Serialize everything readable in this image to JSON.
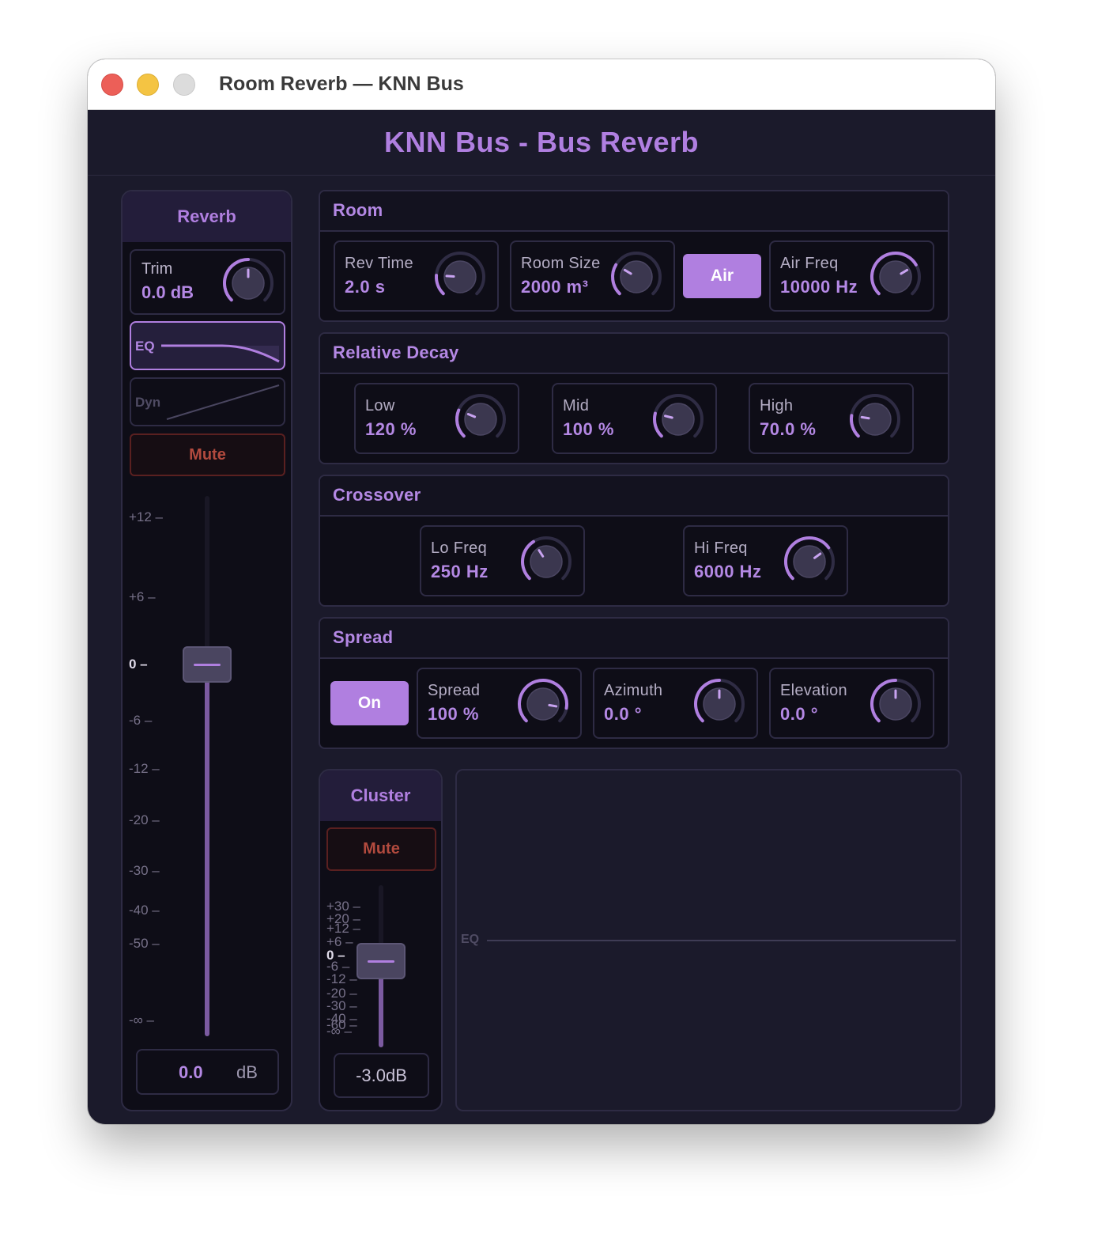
{
  "window": {
    "title": "Room Reverb — KNN Bus"
  },
  "header": {
    "title": "KNN Bus - Bus Reverb"
  },
  "reverb_strip": {
    "title": "Reverb",
    "trim": {
      "label": "Trim",
      "value": "0.0 dB",
      "level": 0.5
    },
    "eq_label": "EQ",
    "dyn_label": "Dyn",
    "mute_label": "Mute",
    "scale": [
      "+12",
      "+6",
      "0",
      "-6",
      "-12",
      "-20",
      "-30",
      "-40",
      "-50",
      "-∞"
    ],
    "fader_db": 0.0,
    "readout_value": "0.0",
    "readout_unit": "dB"
  },
  "room": {
    "title": "Room",
    "rev_time": {
      "label": "Rev Time",
      "value": "2.0 s",
      "level": 0.18
    },
    "room_size": {
      "label": "Room Size",
      "value": "2000 m³",
      "level": 0.28
    },
    "air_button": "Air",
    "air_freq": {
      "label": "Air Freq",
      "value": "10000 Hz",
      "level": 0.72
    }
  },
  "relative_decay": {
    "title": "Relative Decay",
    "low": {
      "label": "Low",
      "value": "120 %",
      "level": 0.25
    },
    "mid": {
      "label": "Mid",
      "value": "100 %",
      "level": 0.22
    },
    "high": {
      "label": "High",
      "value": "70.0 %",
      "level": 0.2
    }
  },
  "crossover": {
    "title": "Crossover",
    "lo_freq": {
      "label": "Lo Freq",
      "value": "250 Hz",
      "level": 0.38
    },
    "hi_freq": {
      "label": "Hi Freq",
      "value": "6000 Hz",
      "level": 0.7
    }
  },
  "spread": {
    "title": "Spread",
    "on_button": "On",
    "spread": {
      "label": "Spread",
      "value": "100 %",
      "level": 0.87
    },
    "azimuth": {
      "label": "Azimuth",
      "value": "0.0 °",
      "level": 0.5
    },
    "elevation": {
      "label": "Elevation",
      "value": "0.0 °",
      "level": 0.5
    }
  },
  "cluster_strip": {
    "title": "Cluster",
    "mute_label": "Mute",
    "scale": [
      "+30",
      "+20",
      "+12",
      "+6",
      "0",
      "-6",
      "-12",
      "-20",
      "-30",
      "-40",
      "-60",
      "-∞"
    ],
    "fader_db": -3.0,
    "readout": "-3.0dB"
  },
  "eq_display": {
    "label": "EQ"
  },
  "colors": {
    "accent": "#b07fe0",
    "background": "#1b1a2b",
    "panel": "#0e0d17",
    "mute": "#b24a3e"
  }
}
